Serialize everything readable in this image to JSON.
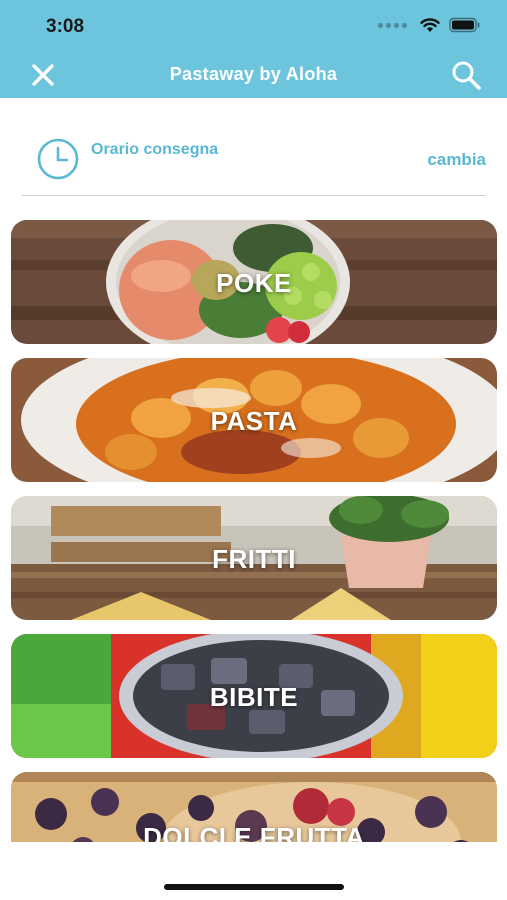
{
  "status_bar": {
    "time": "3:08"
  },
  "nav": {
    "title": "Pastaway by Aloha"
  },
  "delivery": {
    "label": "Orario consegna",
    "change": "cambia"
  },
  "categories": [
    {
      "label": "POKE"
    },
    {
      "label": "PASTA"
    },
    {
      "label": "FRITTI"
    },
    {
      "label": "BIBITE"
    },
    {
      "label": "DOLCI E FRUTTA"
    }
  ],
  "colors": {
    "accent": "#6cc5dd",
    "link": "#5ab8d3",
    "divider": "#cfcfcf"
  },
  "icons": [
    "close-icon",
    "search-icon",
    "clock-icon",
    "wifi-icon",
    "battery-icon"
  ]
}
